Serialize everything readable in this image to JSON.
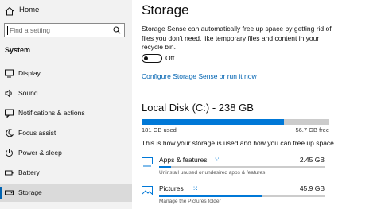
{
  "sidebar": {
    "home_label": "Home",
    "search_placeholder": "Find a setting",
    "section_title": "System",
    "items": [
      {
        "label": "Display",
        "icon": "display-icon"
      },
      {
        "label": "Sound",
        "icon": "sound-icon"
      },
      {
        "label": "Notifications & actions",
        "icon": "notifications-icon"
      },
      {
        "label": "Focus assist",
        "icon": "focus-assist-icon"
      },
      {
        "label": "Power & sleep",
        "icon": "power-icon"
      },
      {
        "label": "Battery",
        "icon": "battery-icon"
      },
      {
        "label": "Storage",
        "icon": "storage-icon",
        "selected": true
      }
    ]
  },
  "main": {
    "title": "Storage",
    "description": "Storage Sense can automatically free up space by getting rid of files you don't need, like temporary files and content in your recycle bin.",
    "toggle_label": "Off",
    "toggle_on": false,
    "configure_link": "Configure Storage Sense or run it now",
    "disk": {
      "title": "Local Disk (C:) - 238 GB",
      "used": "181 GB used",
      "free": "56.7 GB free",
      "used_fraction": 0.76
    },
    "usage_description": "This is how your storage is used and how you can free up space.",
    "categories": [
      {
        "name": "Apps & features",
        "size": "2.45 GB",
        "sub": "Uninstall unused or undesired apps & features",
        "fraction": 0.07,
        "icon": "apps-icon"
      },
      {
        "name": "Pictures",
        "size": "45.9 GB",
        "sub": "Manage the Pictures folder",
        "fraction": 0.62,
        "icon": "pictures-icon"
      }
    ]
  },
  "colors": {
    "accent": "#0078d7",
    "link": "#0063b1",
    "sidebar_bg": "#f2f2f2"
  }
}
